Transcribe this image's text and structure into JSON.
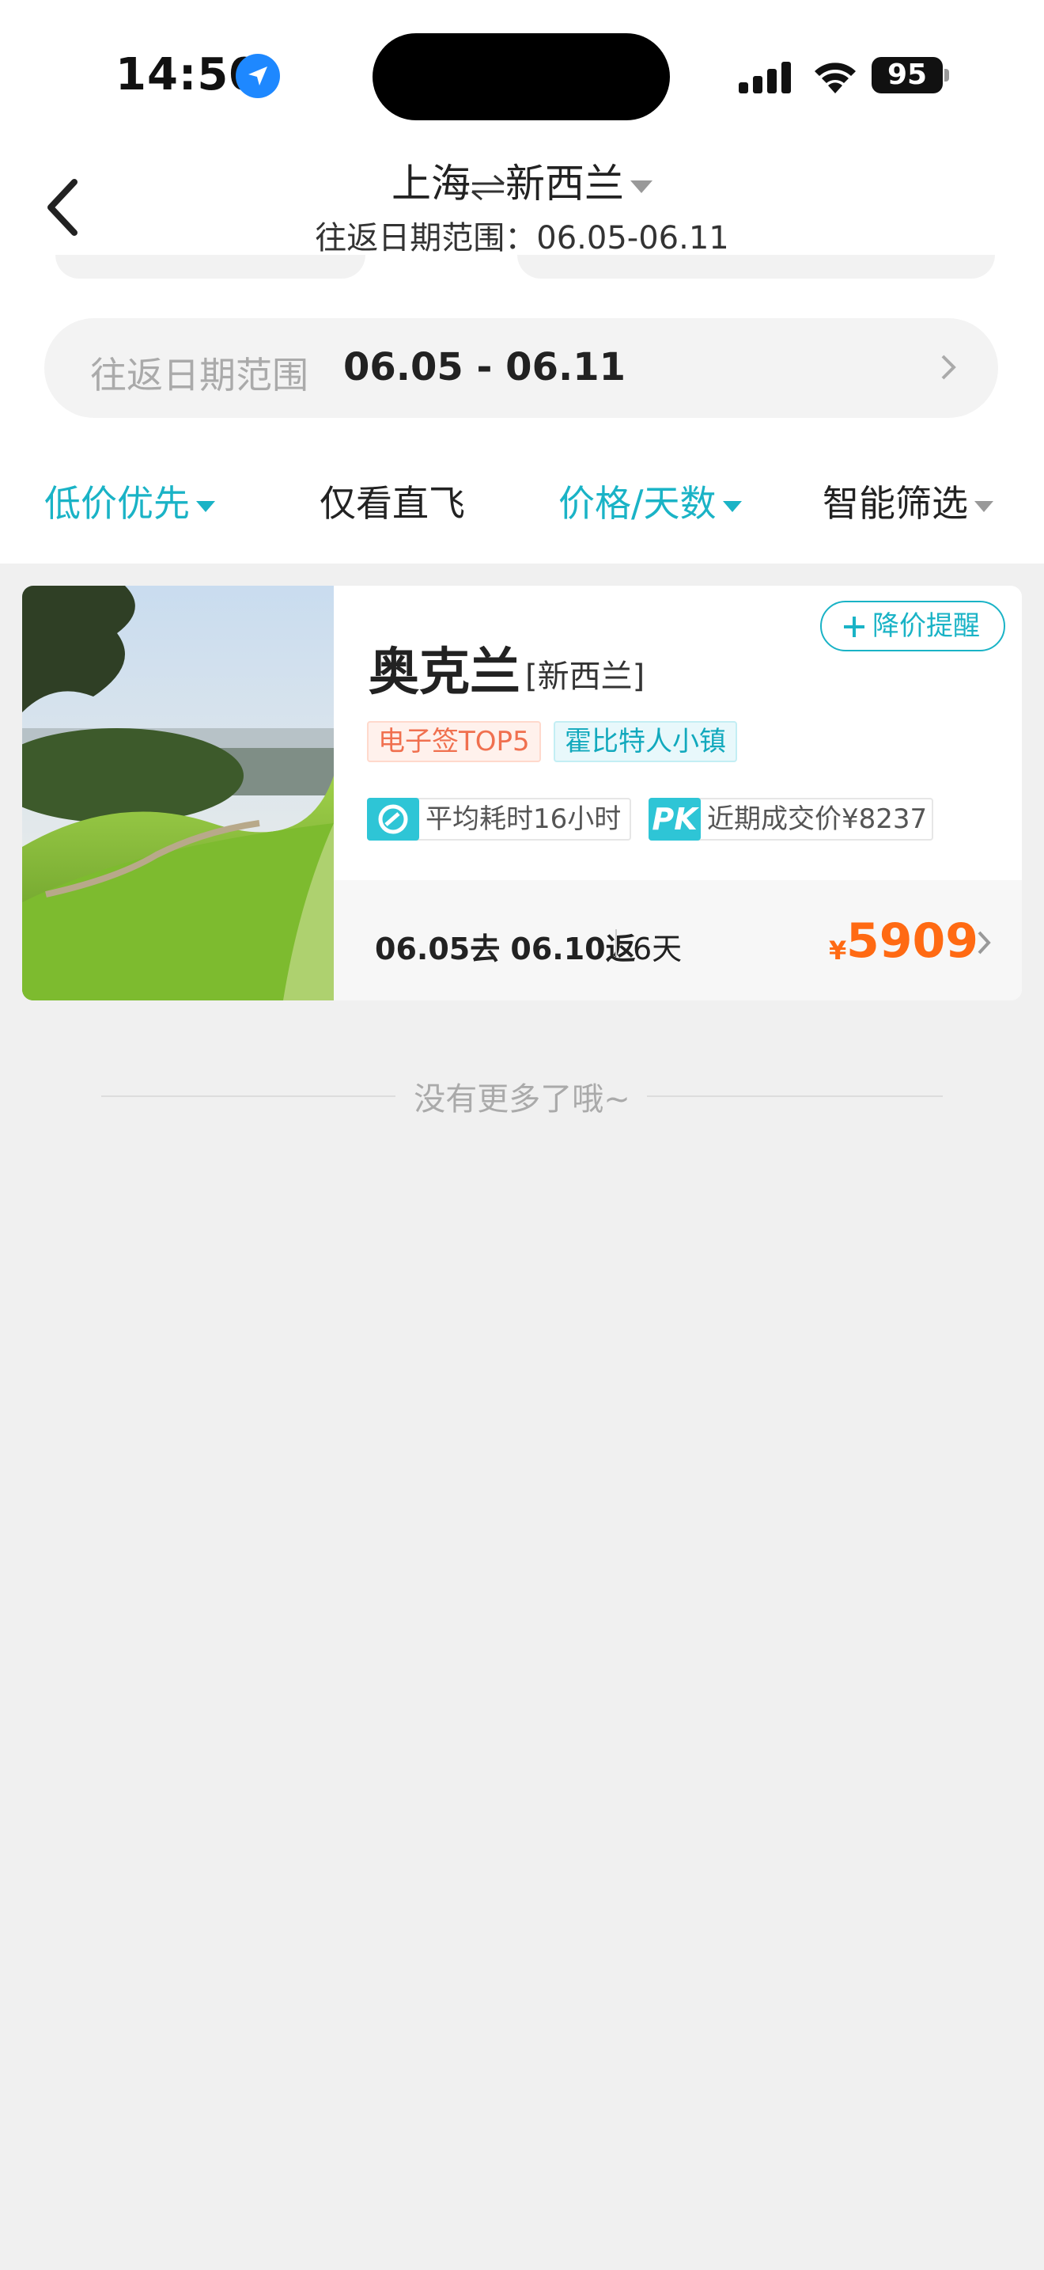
{
  "status_bar": {
    "time": "14:50",
    "battery": "95"
  },
  "nav": {
    "route_from": "上海",
    "route_to": "新西兰",
    "date_subtitle": "往返日期范围：06.05-06.11"
  },
  "date_range": {
    "label": "往返日期范围",
    "value": "06.05 - 06.11"
  },
  "filters": [
    {
      "label": "低价优先",
      "active": true
    },
    {
      "label": "仅看直飞",
      "active": false
    },
    {
      "label": "价格/天数",
      "active": true
    },
    {
      "label": "智能筛选",
      "active": false
    }
  ],
  "result": {
    "price_alert": "降价提醒",
    "city": "奥克兰",
    "country": "[新西兰]",
    "tags": [
      "电子签TOP5",
      "霍比特人小镇"
    ],
    "avg_time": "平均耗时16小时",
    "recent_price": "近期成交价¥8237",
    "pk_label": "PK",
    "dates": "06.05去 06.10返",
    "days": "6天",
    "currency": "¥",
    "price": "5909"
  },
  "footer": {
    "end_text": "没有更多了哦~"
  },
  "colors": {
    "accent": "#1ab3c6",
    "price": "#ff6a13",
    "tag_red": "#f0704f"
  }
}
